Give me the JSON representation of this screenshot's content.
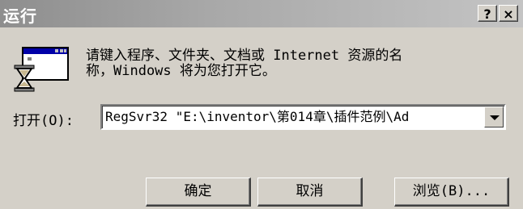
{
  "window": {
    "title": "运行",
    "help_button": "?",
    "close_button": "×"
  },
  "dialog": {
    "description_line1": "请键入程序、文件夹、文档或 Internet 资源的名",
    "description_line2": "称，Windows 将为您打开它。",
    "icon": "run-hourglass-icon",
    "open_label": "打开(O):",
    "command_value": "RegSvr32 \"E:\\inventor\\第014章\\插件范例\\Ad"
  },
  "buttons": {
    "ok": "确定",
    "cancel": "取消",
    "browse": "浏览(B)..."
  }
}
